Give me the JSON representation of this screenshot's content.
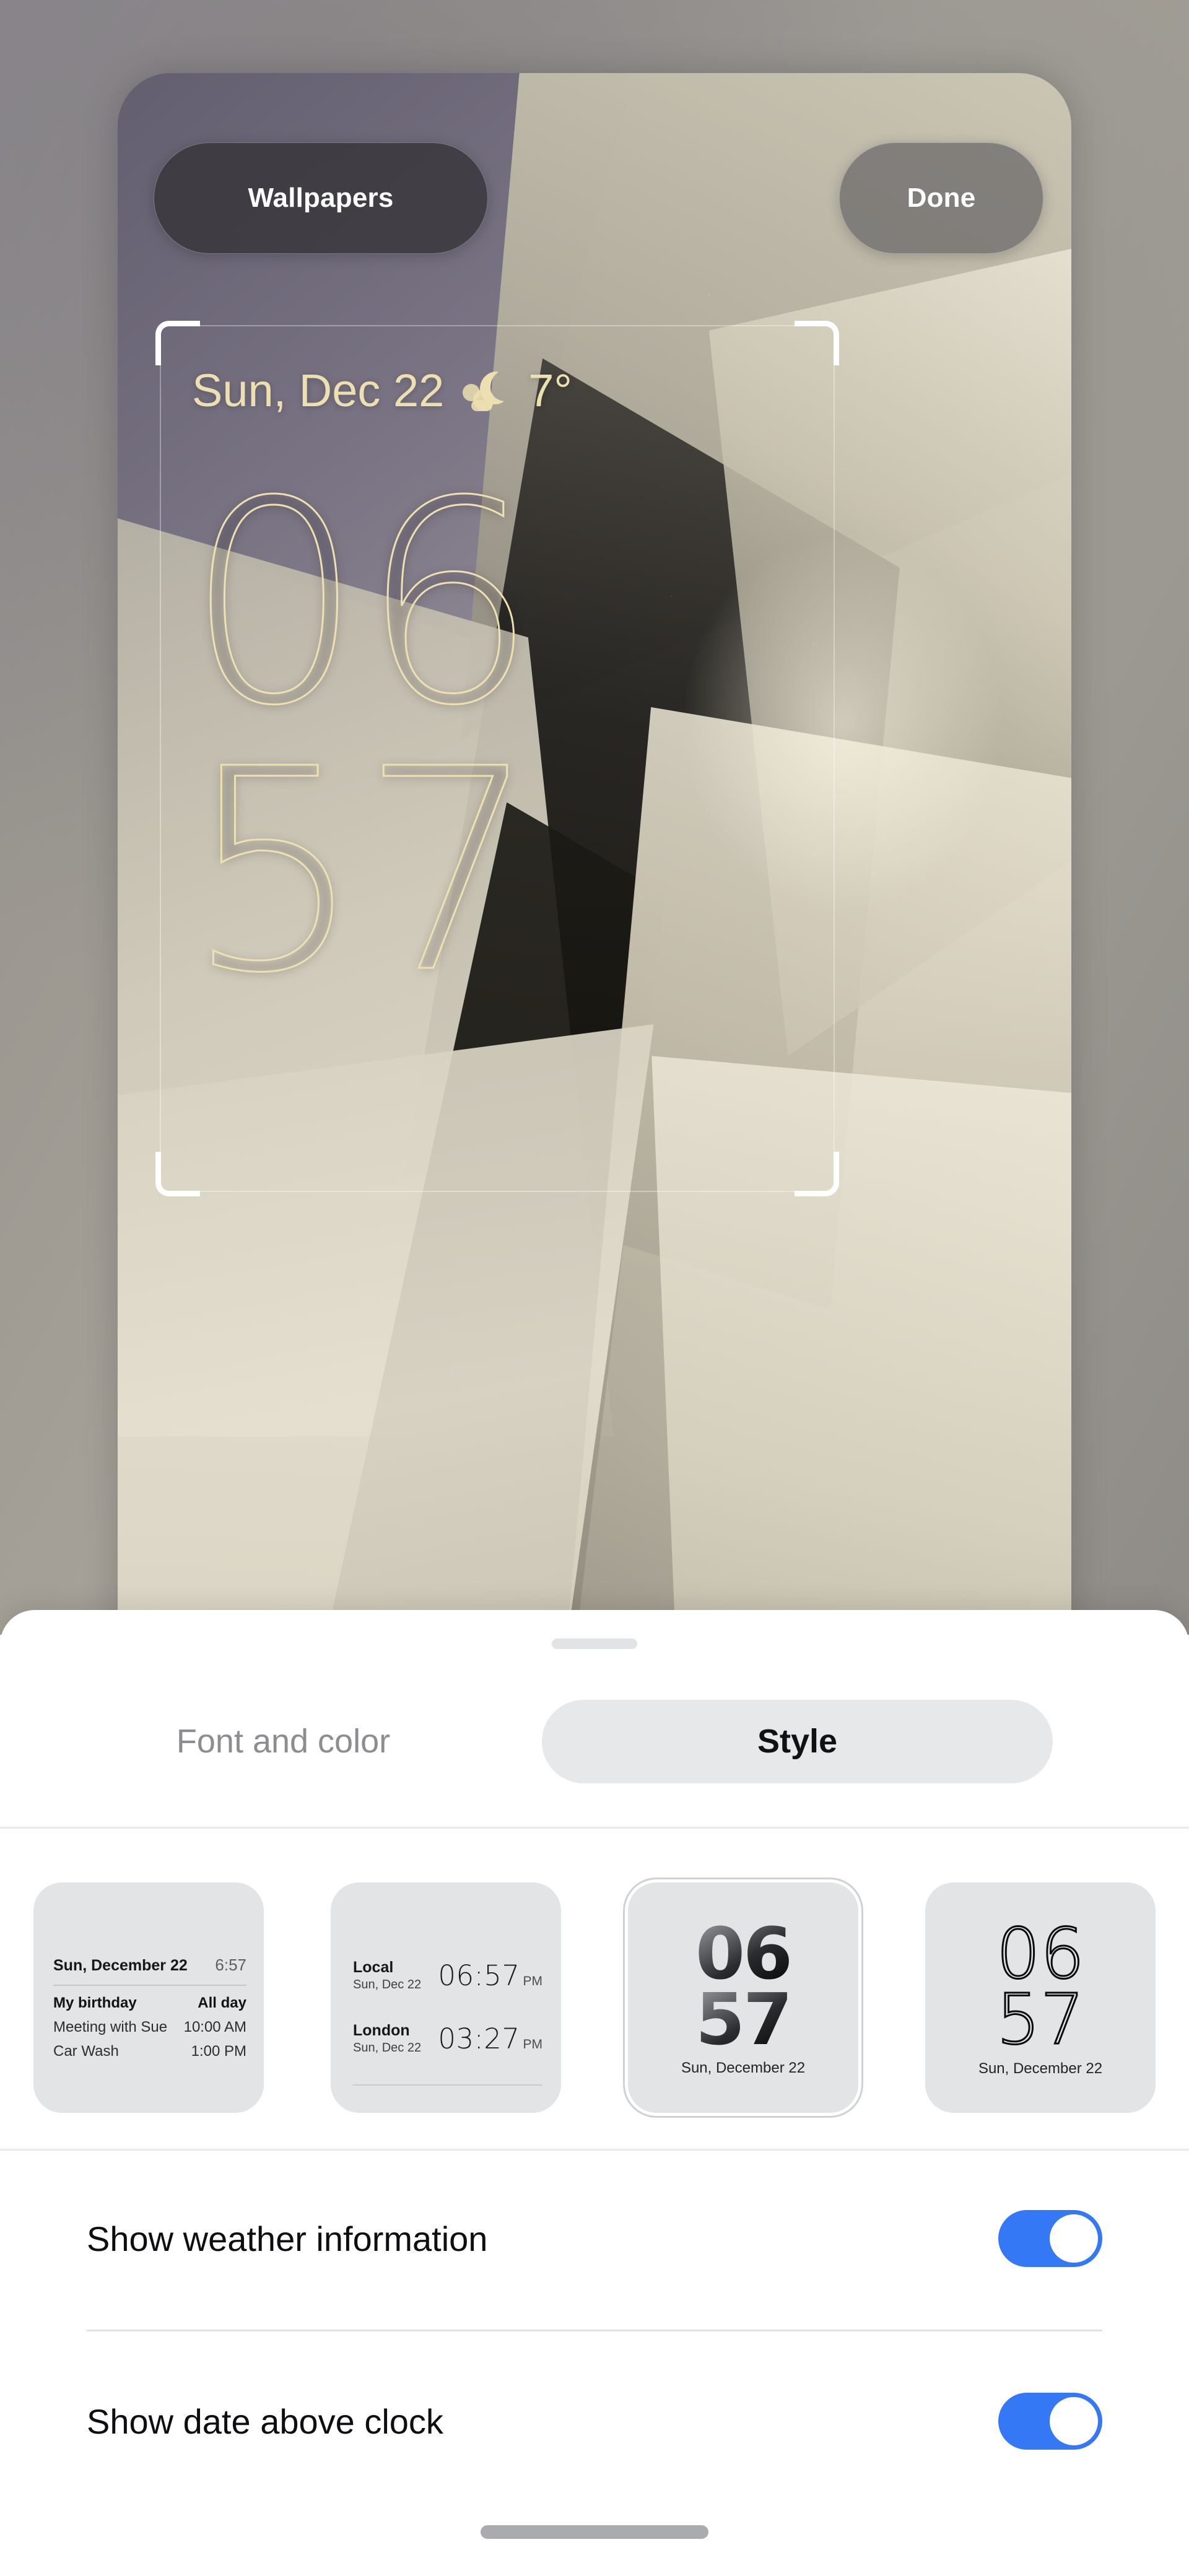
{
  "preview": {
    "buttons": {
      "wallpapers": "Wallpapers",
      "done": "Done"
    },
    "lockscreen": {
      "date": "Sun, Dec 22",
      "weather_icon": "moon-cloud-icon",
      "temperature": "7°",
      "clock_hours": "06",
      "clock_minutes": "57"
    }
  },
  "sheet": {
    "drag_handle": "sheet-drag-handle",
    "tabs": [
      {
        "label": "Font and color",
        "selected": false
      },
      {
        "label": "Style",
        "selected": true
      }
    ],
    "styles": [
      {
        "name": "calendar-style",
        "selected": false,
        "header_date": "Sun, December 22",
        "header_time": "6:57",
        "events": [
          {
            "title": "My birthday",
            "time": "All day",
            "bold": true
          },
          {
            "title": "Meeting with Sue",
            "time": "10:00 AM",
            "bold": false
          },
          {
            "title": "Car Wash",
            "time": "1:00 PM",
            "bold": false
          }
        ]
      },
      {
        "name": "world-clock-style",
        "selected": false,
        "clocks": [
          {
            "city": "Local",
            "date": "Sun, Dec 22",
            "time": "06:57",
            "ampm": "PM"
          },
          {
            "city": "London",
            "date": "Sun, Dec 22",
            "time": "03:27",
            "ampm": "PM"
          }
        ]
      },
      {
        "name": "bold-gradient-clock-style",
        "selected": true,
        "hours": "06",
        "minutes": "57",
        "date": "Sun, December 22"
      },
      {
        "name": "thin-outline-clock-style",
        "selected": false,
        "hours": "06",
        "minutes": "57",
        "date": "Sun, December 22"
      }
    ],
    "settings": [
      {
        "label": "Show weather information",
        "on": true
      },
      {
        "label": "Show date above clock",
        "on": true
      }
    ]
  },
  "colors": {
    "accent_blue": "#3478f6",
    "clock_cream": "#ede0b1",
    "sheet_white": "#ffffff",
    "thumb_gray": "#e3e4e6",
    "tab_selected_bg": "#e7e8ea",
    "divider": "#e9eaec",
    "home_indicator": "#a9abae"
  }
}
